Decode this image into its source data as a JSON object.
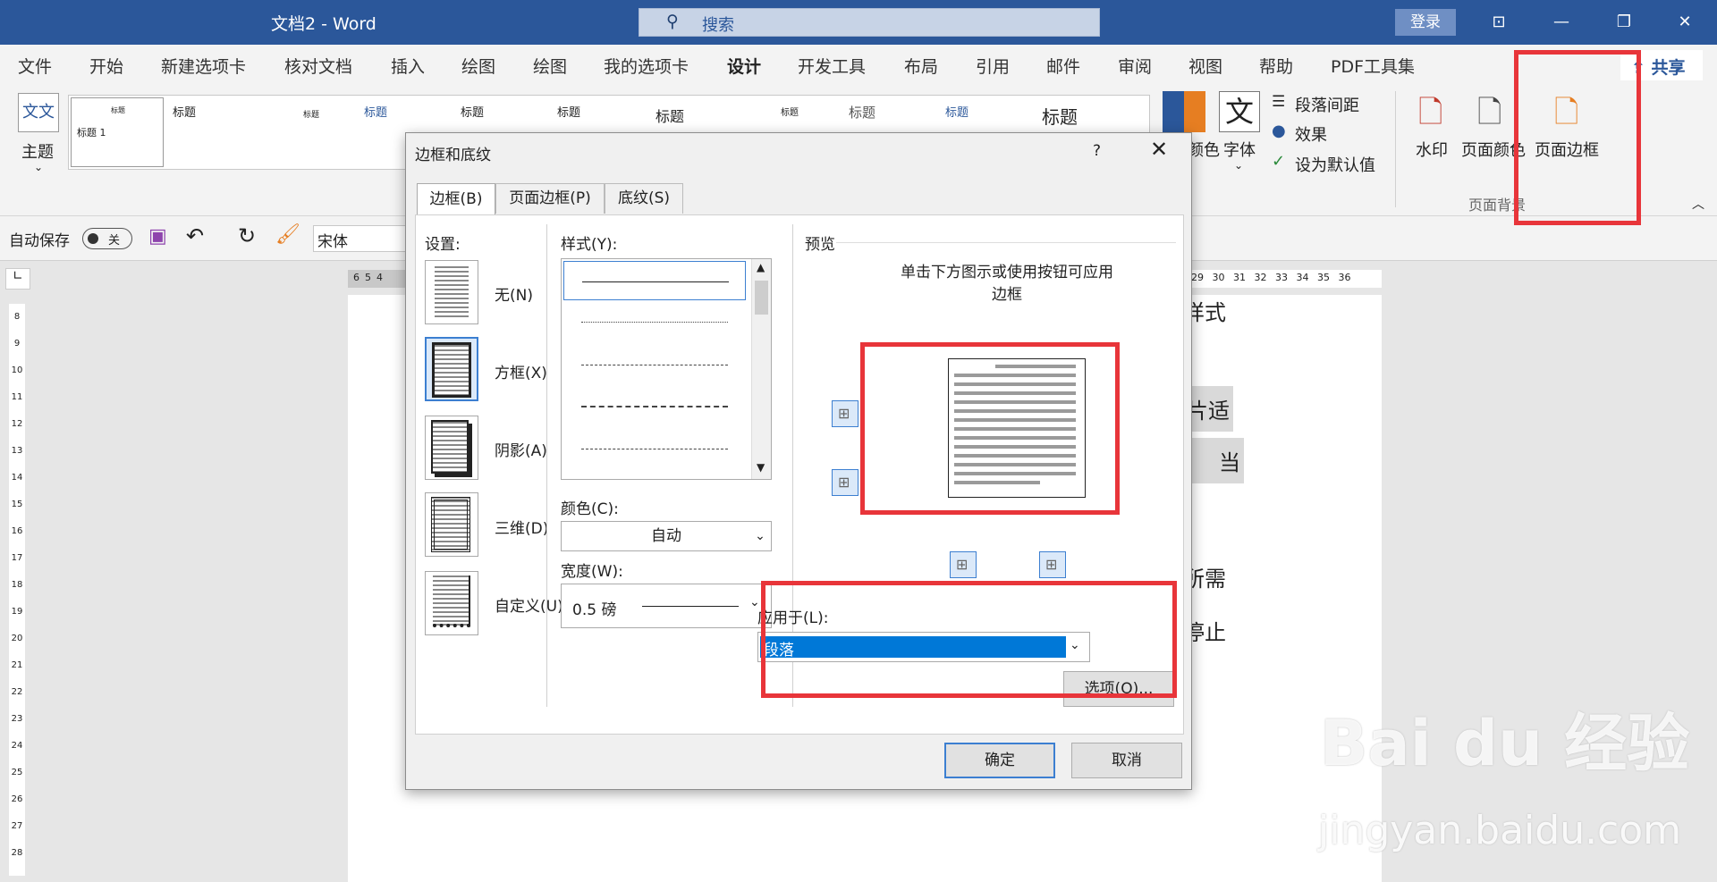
{
  "titlebar": {
    "doc_title": "文档2 - Word",
    "search_placeholder": "搜索",
    "login": "登录"
  },
  "menu": {
    "tabs": [
      "文件",
      "开始",
      "新建选项卡",
      "核对文档",
      "插入",
      "绘图",
      "绘图",
      "我的选项卡",
      "设计",
      "开发工具",
      "布局",
      "引用",
      "邮件",
      "审阅",
      "视图",
      "帮助",
      "PDF工具集"
    ],
    "active_index": 8,
    "share": "共享"
  },
  "ribbon": {
    "theme_label": "主题",
    "theme_icon_text": "文文",
    "gallery_titles": [
      "标题",
      "标题",
      "标题",
      "标题",
      "标题",
      "标题",
      "标题",
      "标题",
      "标题",
      "标题",
      "标题"
    ],
    "gallery_subtitle": "标题 1",
    "colors_label": "颜色",
    "fonts_label": "字体",
    "fonts_icon": "文",
    "paragraph_spacing": "段落间距",
    "effects": "效果",
    "set_default": "设为默认值",
    "watermark": "水印",
    "page_color": "页面颜色",
    "page_border": "页面边框",
    "group_page_background": "页面背景"
  },
  "qat": {
    "autosave": "自动保存",
    "autosave_state": "关",
    "font_name": "宋体"
  },
  "ruler": {
    "ticks_left": [
      "6",
      "5",
      "4"
    ],
    "ticks_right": [
      "29",
      "30",
      "31",
      "32",
      "33",
      "34",
      "35",
      "36"
    ],
    "vticks": [
      "8",
      "9",
      "10",
      "11",
      "12",
      "13",
      "14",
      "15",
      "16",
      "17",
      "18",
      "19",
      "20",
      "21",
      "22",
      "23",
      "24",
      "25",
      "26",
      "27",
      "28"
    ]
  },
  "doc_fragments": [
    "样式",
    "片适",
    "当",
    "所需",
    "停止"
  ],
  "dialog": {
    "title": "边框和底纹",
    "help": "?",
    "tabs": [
      "边框(B)",
      "页面边框(P)",
      "底纹(S)"
    ],
    "setting_label": "设置:",
    "settings": [
      "无(N)",
      "方框(X)",
      "阴影(A)",
      "三维(D)",
      "自定义(U)"
    ],
    "selected_setting": 1,
    "style_label": "样式(Y):",
    "color_label": "颜色(C):",
    "color_value": "自动",
    "width_label": "宽度(W):",
    "width_value": "0.5 磅",
    "preview_label": "预览",
    "preview_hint": "单击下方图示或使用按钮可应用边框",
    "apply_label": "应用于(L):",
    "apply_value": "段落",
    "options_button": "选项(O)...",
    "ok": "确定",
    "cancel": "取消"
  },
  "watermark": {
    "logo": "Bai du 经验",
    "url": "jingyan.baidu.com"
  },
  "colors": {
    "word_blue": "#2b579a",
    "highlight": "#e8353a",
    "selection": "#0078d7"
  }
}
